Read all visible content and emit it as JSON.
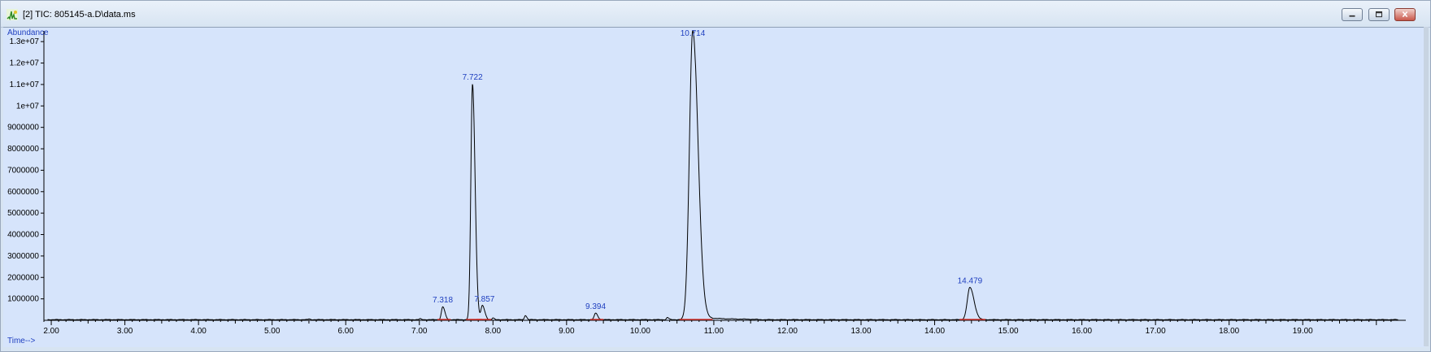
{
  "window": {
    "title": "[2] TIC: 805145-a.D\\data.ms",
    "icon": "chromatogram-app-icon",
    "buttons": [
      "minimize",
      "restore",
      "close"
    ]
  },
  "chart_data": {
    "type": "line",
    "title": "",
    "ylabel": "Abundance",
    "xlabel": "Time-->",
    "xlim": [
      1.9,
      20.4
    ],
    "ylim": [
      0,
      13500000
    ],
    "y_ticks": [
      1000000,
      2000000,
      3000000,
      4000000,
      5000000,
      6000000,
      7000000,
      8000000,
      9000000,
      10000000,
      11000000,
      12000000,
      13000000
    ],
    "y_tick_labels": [
      "1000000",
      "2000000",
      "3000000",
      "4000000",
      "5000000",
      "6000000",
      "7000000",
      "8000000",
      "9000000",
      "1e+07",
      "1.1e+07",
      "1.2e+07",
      "1.3e+07"
    ],
    "x_ticks": [
      2,
      3,
      4,
      5,
      6,
      7,
      8,
      9,
      10,
      11,
      12,
      13,
      14,
      15,
      16,
      17,
      18,
      19
    ],
    "x_tick_labels": [
      "2.00",
      "3.00",
      "4.00",
      "5.00",
      "6.00",
      "7.00",
      "8.00",
      "9.00",
      "10.00",
      "11.00",
      "12.00",
      "13.00",
      "14.00",
      "15.00",
      "16.00",
      "17.00",
      "18.00",
      "19.00"
    ],
    "grid": false,
    "peaks": [
      {
        "rt": 7.318,
        "label": "7.318",
        "height": 600000,
        "width": 0.018
      },
      {
        "rt": 7.722,
        "label": "7.722",
        "height": 11000000,
        "width": 0.022
      },
      {
        "rt": 7.857,
        "label": "7.857",
        "height": 650000,
        "width": 0.02
      },
      {
        "rt": 9.394,
        "label": "9.394",
        "height": 300000,
        "width": 0.018
      },
      {
        "rt": 10.714,
        "label": "10.714",
        "height": 13500000,
        "width": 0.045
      },
      {
        "rt": 14.479,
        "label": "14.479",
        "height": 1500000,
        "width": 0.035
      }
    ],
    "minor_peaks": [
      {
        "rt": 8.44,
        "height": 200000,
        "width": 0.012
      },
      {
        "rt": 7.01,
        "height": 40000,
        "width": 0.01
      },
      {
        "rt": 5.5,
        "height": 30000,
        "width": 0.01
      },
      {
        "rt": 10.37,
        "height": 100000,
        "width": 0.012
      },
      {
        "rt": 8.0,
        "height": 80000,
        "width": 0.01
      }
    ]
  }
}
